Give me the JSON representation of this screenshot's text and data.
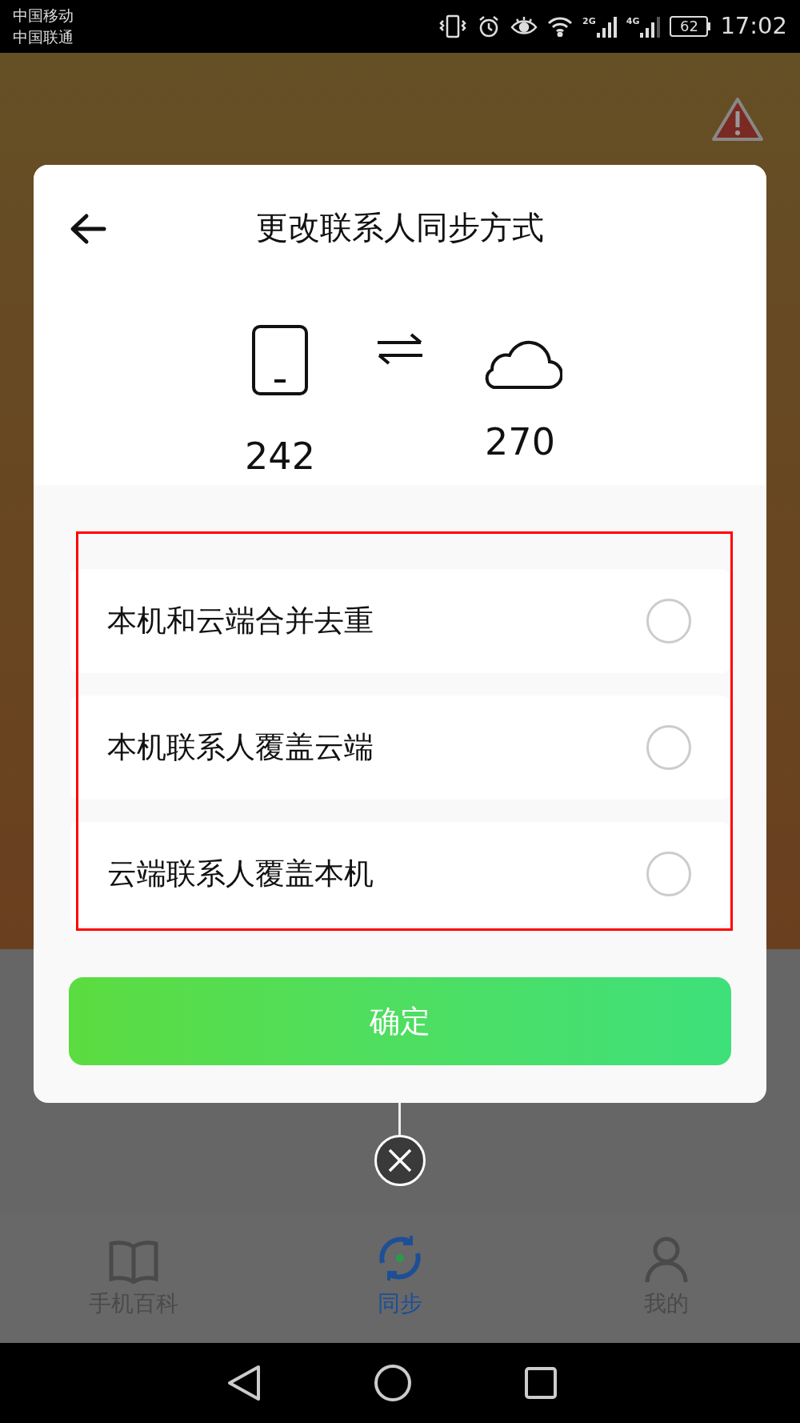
{
  "status_bar": {
    "carriers": [
      "中国移动",
      "中国联通"
    ],
    "signal_2g": "2G",
    "signal_4g": "4G",
    "battery": "62",
    "time": "17:02"
  },
  "dialog": {
    "title": "更改联系人同步方式",
    "phone_count": "242",
    "cloud_count": "270",
    "options": [
      {
        "label": "本机和云端合并去重",
        "selected": false
      },
      {
        "label": "本机联系人覆盖云端",
        "selected": false
      },
      {
        "label": "云端联系人覆盖本机",
        "selected": false
      }
    ],
    "confirm": "确定"
  },
  "bottom_nav": [
    {
      "label": "手机百科",
      "selected": false
    },
    {
      "label": "同步",
      "selected": true
    },
    {
      "label": "我的",
      "selected": false
    }
  ]
}
